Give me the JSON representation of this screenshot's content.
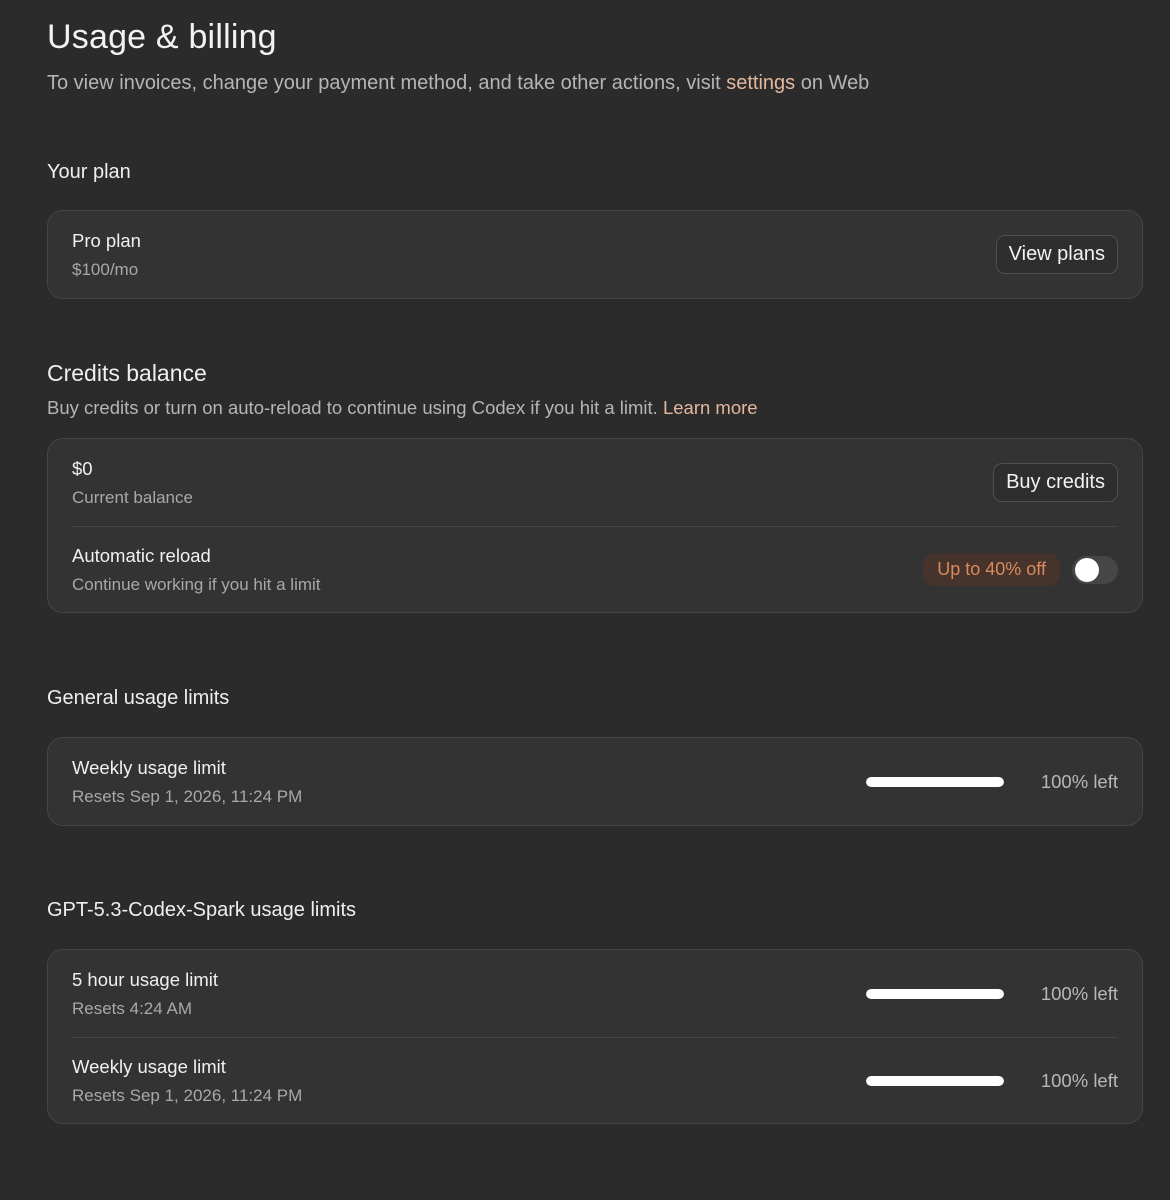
{
  "header": {
    "title": "Usage & billing",
    "subtitle_before": "To view invoices, change your payment method, and take other actions, visit ",
    "subtitle_link": "settings",
    "subtitle_after": " on Web"
  },
  "plan_section": {
    "heading": "Your plan",
    "plan_name": "Pro plan",
    "plan_price": "$100/mo",
    "view_plans_label": "View plans"
  },
  "credits_section": {
    "heading": "Credits balance",
    "description": "Buy credits or turn on auto-reload to continue using Codex if you hit a limit. ",
    "learn_more_label": "Learn more",
    "balance_value": "$0",
    "balance_label": "Current balance",
    "buy_credits_label": "Buy credits",
    "auto_reload_title": "Automatic reload",
    "auto_reload_sub": "Continue working if you hit a limit",
    "discount_badge": "Up to 40% off",
    "auto_reload_enabled": false
  },
  "general_limits": {
    "heading": "General usage limits",
    "items": [
      {
        "title": "Weekly usage limit",
        "reset": "Resets Sep 1, 2026, 11:24 PM",
        "percent_left": 100,
        "value_label": "100% left"
      }
    ]
  },
  "spark_limits": {
    "heading": "GPT-5.3-Codex-Spark usage limits",
    "items": [
      {
        "title": "5 hour usage limit",
        "reset": "Resets 4:24 AM",
        "percent_left": 100,
        "value_label": "100% left"
      },
      {
        "title": "Weekly usage limit",
        "reset": "Resets Sep 1, 2026, 11:24 PM",
        "percent_left": 100,
        "value_label": "100% left"
      }
    ]
  },
  "colors": {
    "background": "#2b2b2b",
    "card": "#333333",
    "accent_link": "#e3b79c",
    "badge_text": "#d98a5e",
    "badge_bg": "#46332b"
  }
}
